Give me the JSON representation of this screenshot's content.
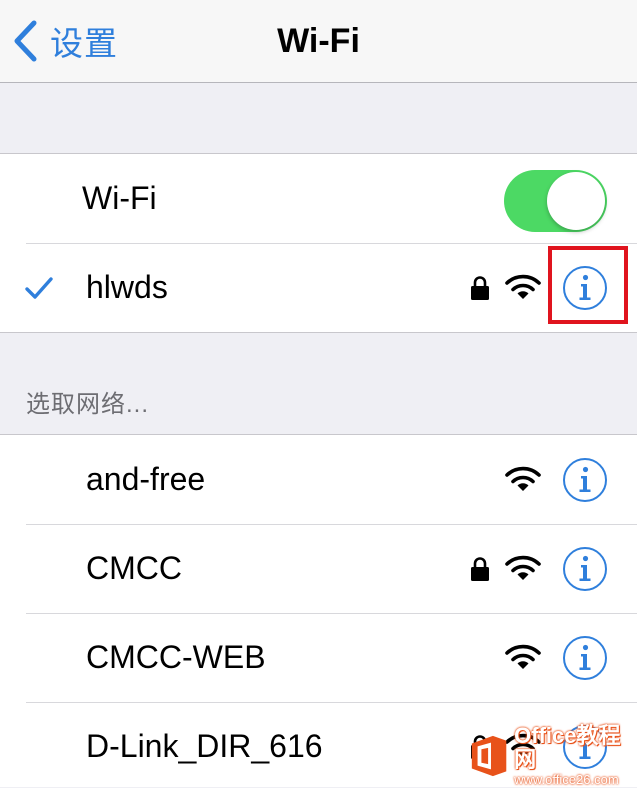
{
  "nav": {
    "back_label": "设置",
    "title": "Wi-Fi"
  },
  "wifi_toggle": {
    "label": "Wi-Fi",
    "on": true
  },
  "connected": {
    "name": "hlwds",
    "secured": true
  },
  "section_header": "选取网络...",
  "networks": [
    {
      "name": "and-free",
      "secured": false
    },
    {
      "name": "CMCC",
      "secured": true
    },
    {
      "name": "CMCC-WEB",
      "secured": false
    },
    {
      "name": "D-Link_DIR_616",
      "secured": true
    }
  ],
  "icons": {
    "back": "chevron-left-icon",
    "check": "checkmark-icon",
    "lock": "lock-icon",
    "wifi": "wifi-signal-icon",
    "info": "info-icon"
  },
  "colors": {
    "accent": "#2f7fdc",
    "toggle_on": "#4cd964",
    "highlight": "#e0141e",
    "watermark": "#e8521a"
  },
  "watermark": {
    "name": "Office教程网",
    "url": "www.office26.com"
  }
}
